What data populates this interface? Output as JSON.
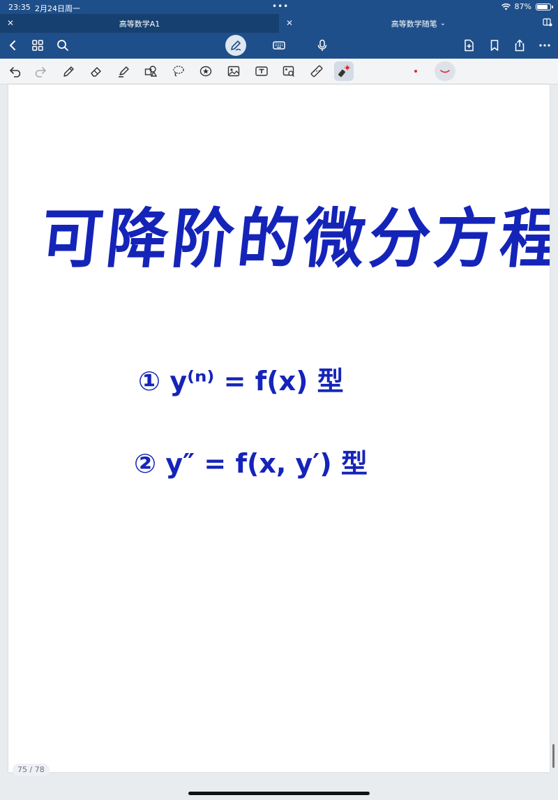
{
  "status_bar": {
    "time": "23:35",
    "date": "2月24日周一",
    "battery": "87%",
    "battery_level": 0.87
  },
  "tabs": [
    {
      "label": "高等数学A1"
    },
    {
      "label": "高等数学随笔"
    }
  ],
  "tab_dropdown": "⌄",
  "note": {
    "title": "可降阶的微分方程",
    "item1": "① y⁽ⁿ⁾ = f(x) 型",
    "item2": "② y″ = f(x, y′) 型"
  },
  "page_indicator": "75 / 78",
  "colors": {
    "chrome": "#1f4f8a",
    "ink": "#1524b8",
    "toolbar": "#f3f4f6"
  }
}
